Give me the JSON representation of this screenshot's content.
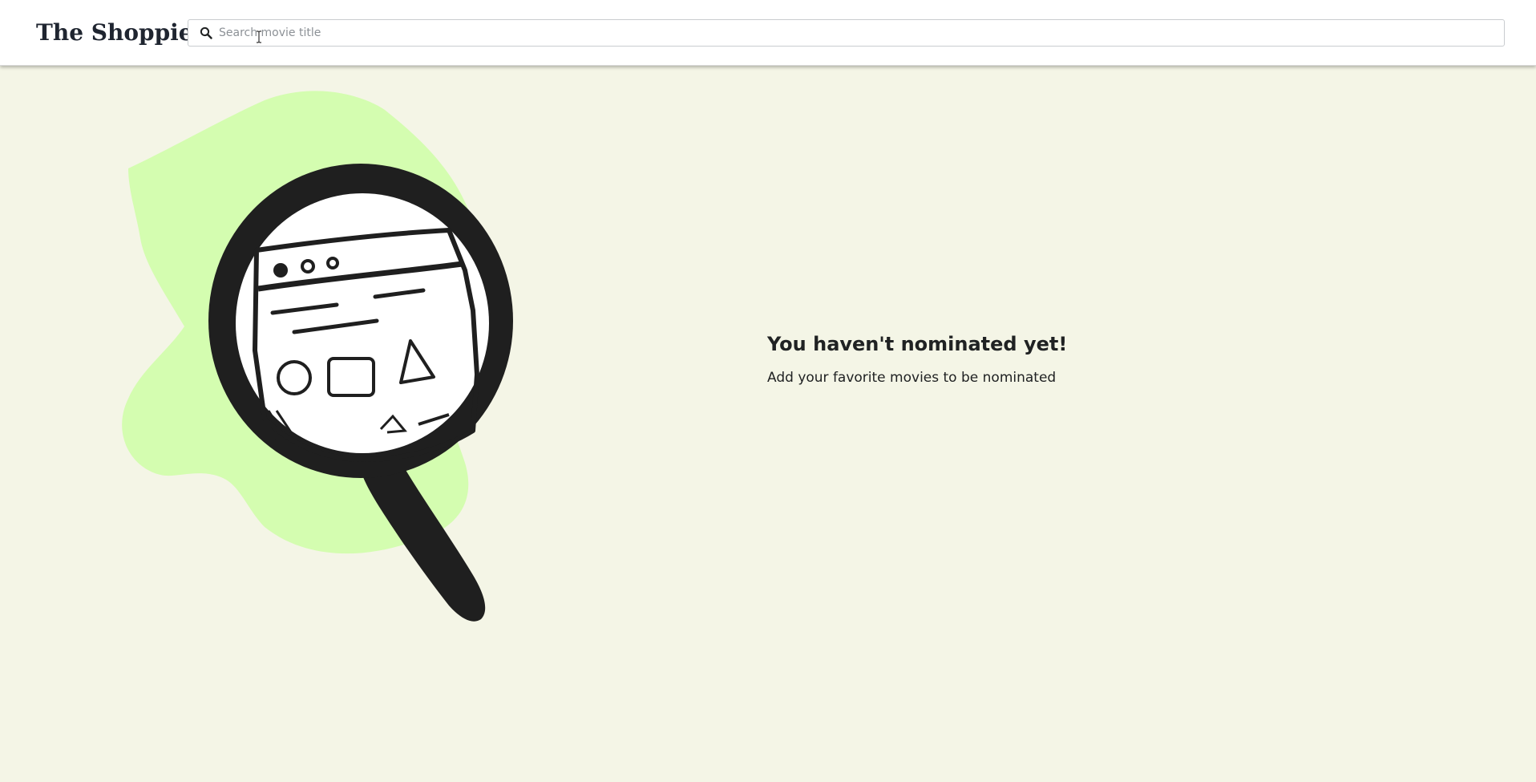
{
  "header": {
    "brand": "The Shoppies",
    "search": {
      "placeholder": "Search movie title",
      "value": "",
      "icon": "search-icon"
    }
  },
  "empty_state": {
    "title": "You haven't nominated yet!",
    "subtitle": "Add your favorite movies to be nominated",
    "illustration": "magnifying-glass-over-browser-window"
  },
  "colors": {
    "background": "#f4f5e6",
    "accent_blob": "#d4fdb0",
    "ink": "#1f1f1f",
    "header_bg": "#ffffff",
    "text": "#202223"
  }
}
